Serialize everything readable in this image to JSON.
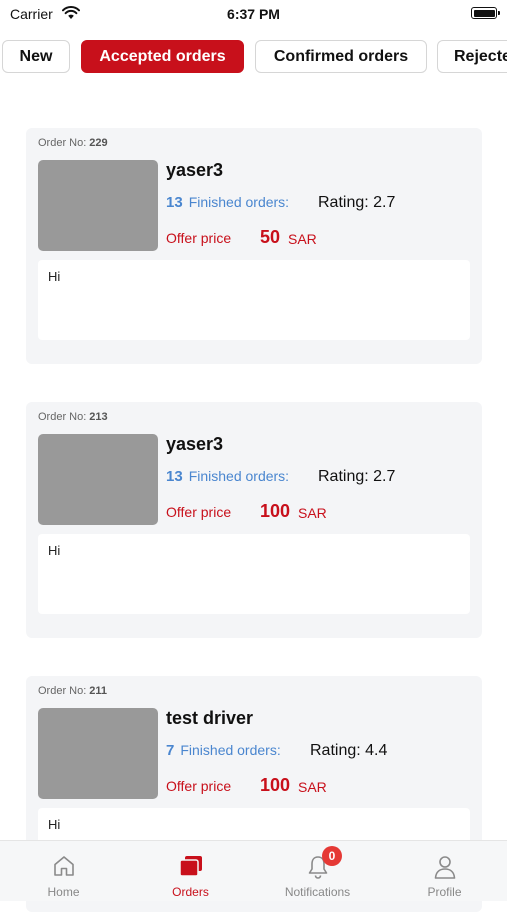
{
  "status_bar": {
    "carrier": "Carrier",
    "time": "6:37 PM"
  },
  "tabs": [
    {
      "label": "New",
      "active": false
    },
    {
      "label": "Accepted orders",
      "active": true
    },
    {
      "label": "Confirmed orders",
      "active": false
    },
    {
      "label": "Rejected orders",
      "active": false
    }
  ],
  "order_label": "Order No:",
  "finished_label": "Finished orders:",
  "rating_label": "Rating:",
  "offer_label": "Offer price",
  "currency": "SAR",
  "orders": [
    {
      "order_no": "229",
      "name": "yaser3",
      "finished": "13",
      "rating": "2.7",
      "price": "50",
      "message": "Hi"
    },
    {
      "order_no": "213",
      "name": "yaser3",
      "finished": "13",
      "rating": "2.7",
      "price": "100",
      "message": "Hi"
    },
    {
      "order_no": "211",
      "name": "test driver",
      "finished": "7",
      "rating": "4.4",
      "price": "100",
      "message": "Hi"
    }
  ],
  "bottom_nav": {
    "home": "Home",
    "orders": "Orders",
    "notifications": "Notifications",
    "profile": "Profile",
    "notification_count": "0"
  },
  "colors": {
    "accent": "#c8101b",
    "link": "#4a86cf",
    "badge": "#e53935"
  }
}
